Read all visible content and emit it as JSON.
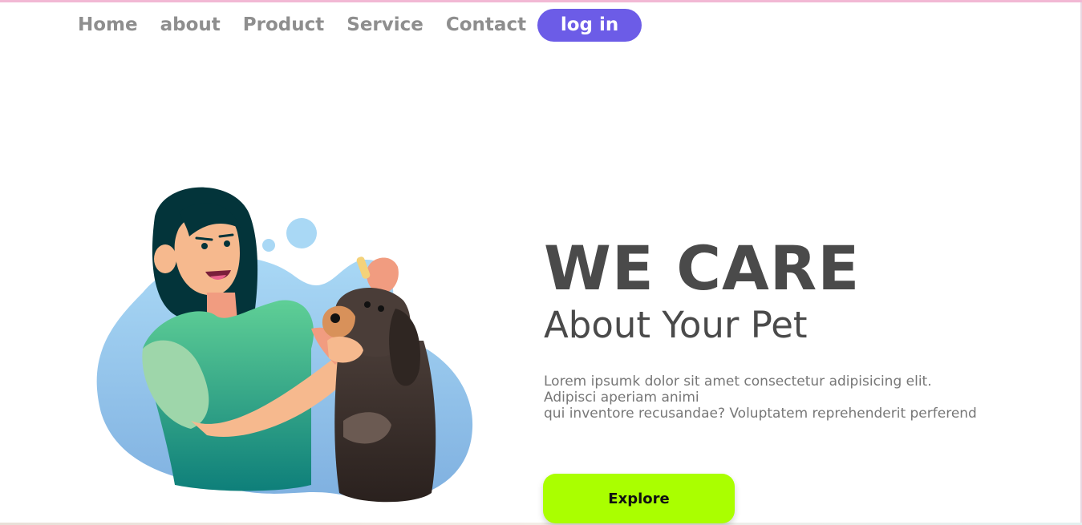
{
  "nav": {
    "items": [
      {
        "label": "Home"
      },
      {
        "label": "about"
      },
      {
        "label": "Product"
      },
      {
        "label": "Service"
      },
      {
        "label": "Contact"
      }
    ],
    "login_label": "log in"
  },
  "hero": {
    "headline": "WE CARE",
    "subheadline": "About Your Pet",
    "body_lines": [
      "Lorem ipsumk dolor sit amet consectetur adipisicing elit.",
      "Adipisci aperiam animi",
      "qui inventore recusandae? Voluptatem reprehenderit perferend"
    ],
    "cta_label": "Explore"
  },
  "colors": {
    "accent_login": "#6c5ce7",
    "accent_cta": "#aaff00",
    "headline_text": "#4a4a4a",
    "nav_text": "#8e8e8e"
  }
}
